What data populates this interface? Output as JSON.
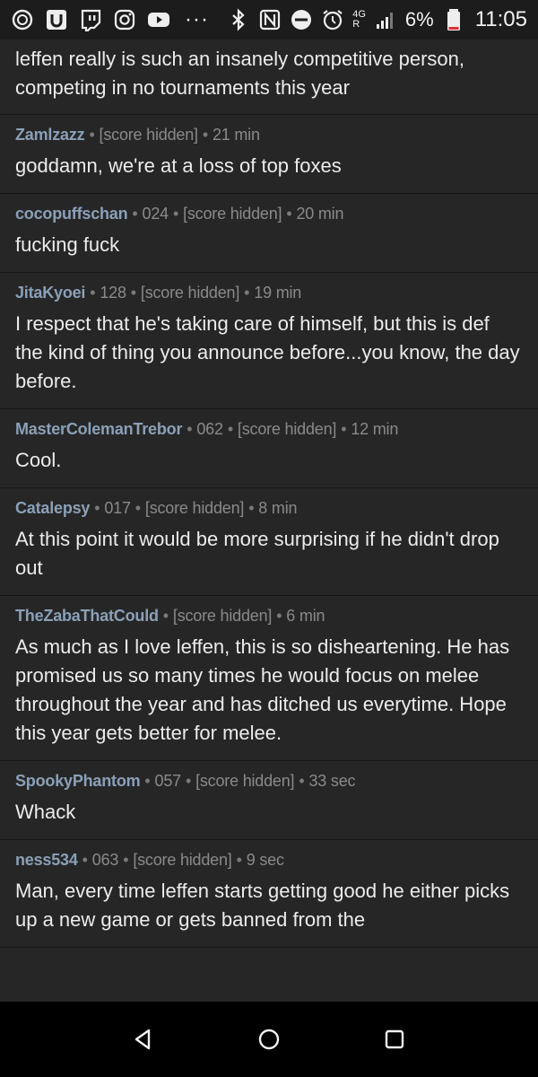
{
  "status_bar": {
    "left_icons": [
      "data-saver-icon",
      "uplay-icon",
      "twitch-icon",
      "instagram-icon",
      "youtube-icon"
    ],
    "overflow": "···",
    "network_top": "4G",
    "network_sub": "R",
    "battery_percent": "6%",
    "time": "11:05"
  },
  "comments": [
    {
      "user": "",
      "karma": "",
      "score": "",
      "age": "",
      "body": "leffen really is such an insanely competitive person, competing in no tournaments this year"
    },
    {
      "user": "Zamlzazz",
      "karma": "",
      "score": "[score hidden]",
      "age": "21 min",
      "body": "goddamn, we're at a loss of top foxes"
    },
    {
      "user": "cocopuffschan",
      "karma": "024",
      "score": "[score hidden]",
      "age": "20 min",
      "body": "fucking fuck"
    },
    {
      "user": "JitaKyoei",
      "karma": "128",
      "score": "[score hidden]",
      "age": "19 min",
      "body": "I respect that he's taking care of himself, but this is def the kind of thing you announce before...you know, the day before."
    },
    {
      "user": "MasterColemanTrebor",
      "karma": "062",
      "score": "[score hidden]",
      "age": "12 min",
      "body": "Cool."
    },
    {
      "user": "Catalepsy",
      "karma": "017",
      "score": "[score hidden]",
      "age": "8 min",
      "body": "At this point it would be more surprising if he didn't drop out"
    },
    {
      "user": "TheZabaThatCould",
      "karma": "",
      "score": "[score hidden]",
      "age": "6 min",
      "body": "As much as I love leffen, this is so disheartening. He has promised us so many times he would focus on melee throughout the year and has ditched us everytime. Hope this year gets better for melee."
    },
    {
      "user": "SpookyPhantom",
      "karma": "057",
      "score": "[score hidden]",
      "age": "33 sec",
      "body": "Whack"
    },
    {
      "user": "ness534",
      "karma": "063",
      "score": "[score hidden]",
      "age": "9 sec",
      "body": "Man, every time leffen starts getting good he either picks up a new game or gets banned from the"
    }
  ],
  "nav_bar": {
    "buttons": [
      "back-icon",
      "home-icon",
      "recents-icon"
    ]
  },
  "colors": {
    "background": "#262626",
    "username": "#8aa0b8",
    "meta": "#8a8a8a",
    "text": "#ececec"
  }
}
